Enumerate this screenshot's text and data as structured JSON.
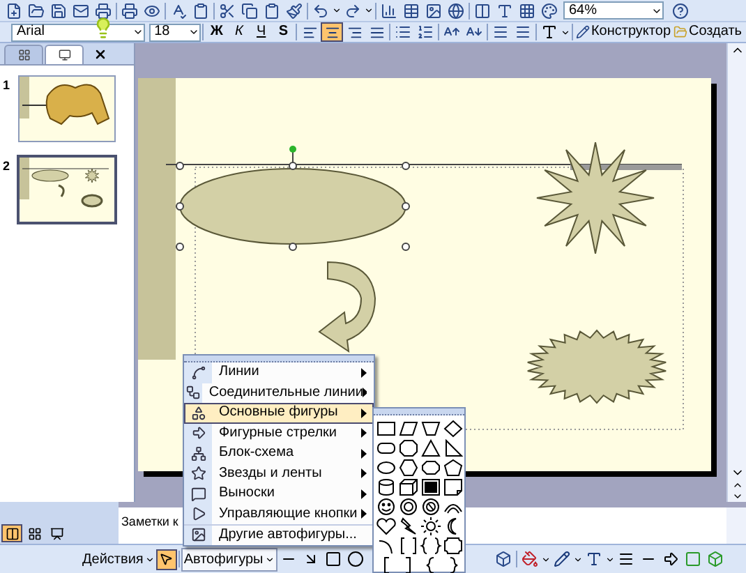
{
  "toolbar_standard": {
    "zoom": "64%"
  },
  "toolbar_formatting": {
    "font": "Arial",
    "size": "18",
    "style_buttons": [
      "Ж",
      "К",
      "Ч",
      "S"
    ],
    "align": [
      {
        "selected": false
      },
      {
        "selected": true
      },
      {
        "selected": false
      },
      {
        "selected": false
      }
    ],
    "buttons": [
      "Конструктор",
      "Создать"
    ]
  },
  "panel_tabs": [
    {
      "selected": false
    },
    {
      "selected": true
    }
  ],
  "slides": [
    {
      "number": "1",
      "selected": false
    },
    {
      "number": "2",
      "selected": true
    }
  ],
  "notes": {
    "text": "Заметки к"
  },
  "view_buttons": [
    {
      "selected": true
    },
    {
      "selected": false
    },
    {
      "selected": false
    }
  ],
  "drawing_toolbar": {
    "actions": "Действия",
    "autoshapes": "Автофигуры",
    "pointer_selected": true
  },
  "menu": {
    "items": [
      {
        "label": "Линии",
        "selected": false,
        "submenu": true
      },
      {
        "label": "Соединительные линии",
        "selected": false,
        "submenu": true
      },
      {
        "label": "Основные фигуры",
        "selected": true,
        "submenu": true
      },
      {
        "label": "Фигурные стрелки",
        "selected": false,
        "submenu": true
      },
      {
        "label": "Блок-схема",
        "selected": false,
        "submenu": true
      },
      {
        "label": "Звезды и ленты",
        "selected": false,
        "submenu": true
      },
      {
        "label": "Выноски",
        "selected": false,
        "submenu": true
      },
      {
        "label": "Управляющие кнопки",
        "selected": false,
        "submenu": true
      },
      {
        "label": "Другие автофигуры...",
        "selected": false,
        "submenu": false
      }
    ]
  }
}
